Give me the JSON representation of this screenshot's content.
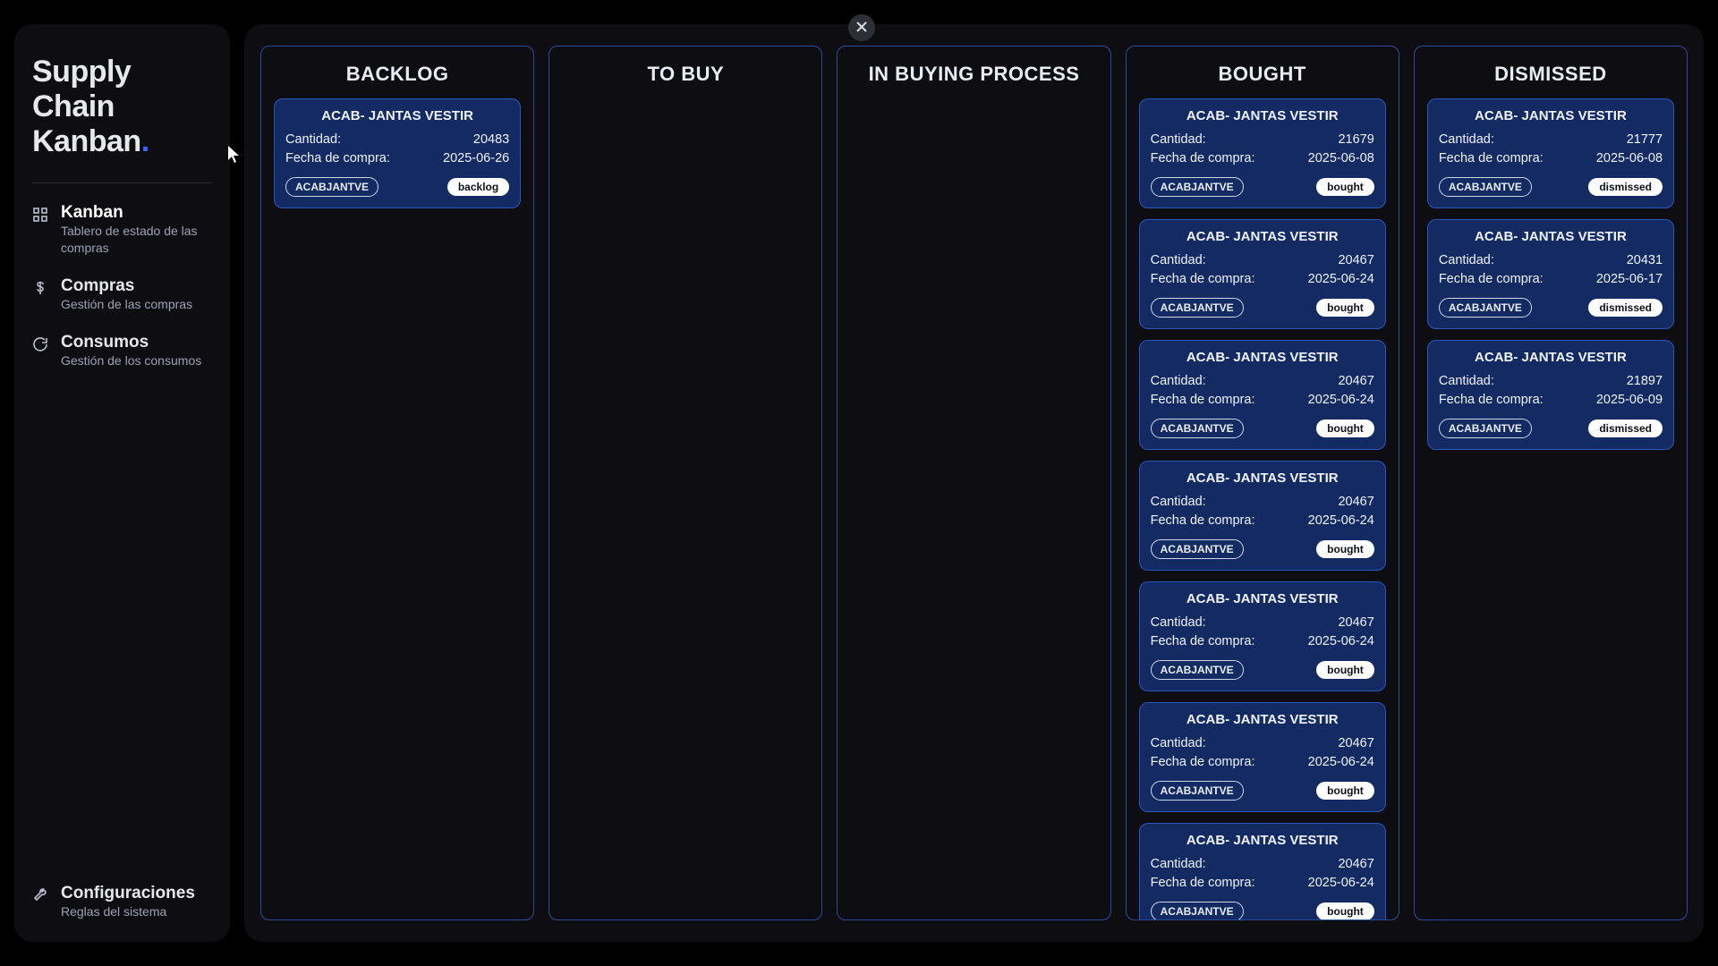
{
  "brand": {
    "line1": "Supply Chain",
    "line2": "Kanban"
  },
  "labels": {
    "quantity": "Cantidad:",
    "purchaseDate": "Fecha de compra:"
  },
  "sidebar": {
    "items": [
      {
        "label": "Kanban",
        "sub": "Tablero de estado de las compras"
      },
      {
        "label": "Compras",
        "sub": "Gestión de las compras"
      },
      {
        "label": "Consumos",
        "sub": "Gestión de los consumos"
      }
    ],
    "settings": {
      "label": "Configuraciones",
      "sub": "Reglas del sistema"
    }
  },
  "columns": [
    {
      "title": "BACKLOG",
      "cards": [
        {
          "title": "ACAB- JANTAS VESTIR",
          "qty": "20483",
          "date": "2025-06-26",
          "code": "ACABJANTVE",
          "status": "backlog"
        }
      ]
    },
    {
      "title": "TO BUY",
      "cards": []
    },
    {
      "title": "IN BUYING PROCESS",
      "cards": []
    },
    {
      "title": "BOUGHT",
      "cards": [
        {
          "title": "ACAB- JANTAS VESTIR",
          "qty": "21679",
          "date": "2025-06-08",
          "code": "ACABJANTVE",
          "status": "bought"
        },
        {
          "title": "ACAB- JANTAS VESTIR",
          "qty": "20467",
          "date": "2025-06-24",
          "code": "ACABJANTVE",
          "status": "bought"
        },
        {
          "title": "ACAB- JANTAS VESTIR",
          "qty": "20467",
          "date": "2025-06-24",
          "code": "ACABJANTVE",
          "status": "bought"
        },
        {
          "title": "ACAB- JANTAS VESTIR",
          "qty": "20467",
          "date": "2025-06-24",
          "code": "ACABJANTVE",
          "status": "bought"
        },
        {
          "title": "ACAB- JANTAS VESTIR",
          "qty": "20467",
          "date": "2025-06-24",
          "code": "ACABJANTVE",
          "status": "bought"
        },
        {
          "title": "ACAB- JANTAS VESTIR",
          "qty": "20467",
          "date": "2025-06-24",
          "code": "ACABJANTVE",
          "status": "bought"
        },
        {
          "title": "ACAB- JANTAS VESTIR",
          "qty": "20467",
          "date": "2025-06-24",
          "code": "ACABJANTVE",
          "status": "bought"
        }
      ]
    },
    {
      "title": "DISMISSED",
      "cards": [
        {
          "title": "ACAB- JANTAS VESTIR",
          "qty": "21777",
          "date": "2025-06-08",
          "code": "ACABJANTVE",
          "status": "dismissed"
        },
        {
          "title": "ACAB- JANTAS VESTIR",
          "qty": "20431",
          "date": "2025-06-17",
          "code": "ACABJANTVE",
          "status": "dismissed"
        },
        {
          "title": "ACAB- JANTAS VESTIR",
          "qty": "21897",
          "date": "2025-06-09",
          "code": "ACABJANTVE",
          "status": "dismissed"
        }
      ]
    }
  ]
}
